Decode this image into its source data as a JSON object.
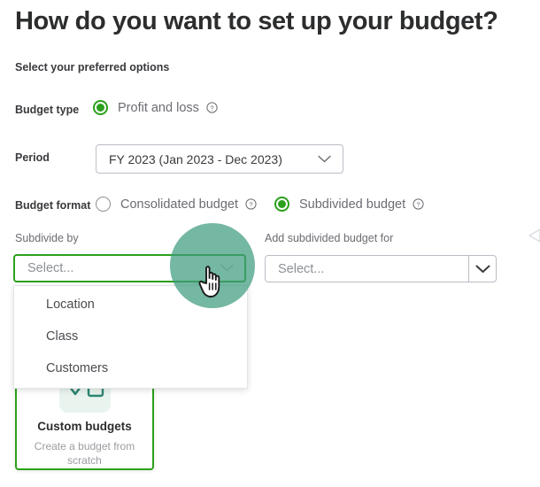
{
  "header": {
    "title": "How do you want to set up your budget?",
    "subtitle": "Select your preferred options"
  },
  "form": {
    "budget_type": {
      "label": "Budget type",
      "option_label": "Profit and loss",
      "selected": true,
      "help_icon": "help-circle-icon"
    },
    "period": {
      "label": "Period",
      "value": "FY 2023 (Jan 2023 - Dec 2023)",
      "chevron_icon": "chevron-down-icon"
    },
    "budget_format": {
      "label": "Budget format",
      "options": [
        {
          "label": "Consolidated budget",
          "selected": false,
          "help_icon": "help-circle-icon"
        },
        {
          "label": "Subdivided budget",
          "selected": true,
          "help_icon": "help-circle-icon"
        }
      ]
    },
    "subdivide_by": {
      "label": "Subdivide by",
      "placeholder": "Select...",
      "value": "",
      "focused": true,
      "chevron_icon": "chevron-down-icon",
      "menu_open": true,
      "menu_items": [
        "Location",
        "Class",
        "Customers"
      ]
    },
    "add_subdivided_budget_for": {
      "label": "Add subdivided budget for",
      "placeholder": "Select...",
      "value": "",
      "chevron_icon": "chevron-down-icon"
    }
  },
  "cards": [
    {
      "title": "Custom budgets",
      "subtitle": "Create a budget from scratch",
      "icon": "chevron-and-square-icon",
      "selected": true
    }
  ],
  "cursor": {
    "icon": "pointing-hand-cursor",
    "click_highlight": true
  },
  "edge": {
    "icon": "arrow-left-icon"
  },
  "colors": {
    "accent_green": "#2ca01c",
    "ripple_green": "#3f9b7e",
    "card_icon_teal": "#2b8573",
    "text_primary": "#393a3d",
    "text_muted": "#6b6c72",
    "placeholder": "#8d9096",
    "border": "#babec5"
  }
}
